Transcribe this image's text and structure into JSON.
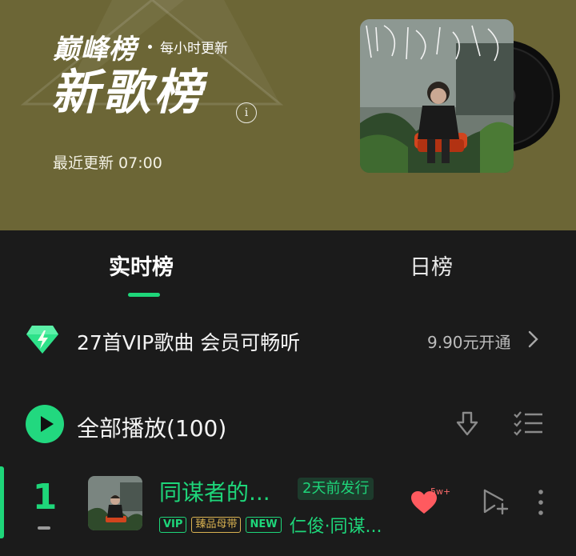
{
  "header": {
    "brand": "巅峰榜",
    "subtitle": "每小时更新",
    "title": "新歌榜",
    "last_updated": "最近更新 07:00",
    "background_color": "#6c6636"
  },
  "tabs": [
    {
      "label": "实时榜",
      "active": true
    },
    {
      "label": "日榜",
      "active": false
    }
  ],
  "vip_banner": {
    "text": "27首VIP歌曲 会员可畅听",
    "price": "9.90元开通"
  },
  "play_all": {
    "label": "全部播放(100)"
  },
  "songs": [
    {
      "rank": "1",
      "title": "同谋者的...",
      "release": "2天前发行",
      "tags": [
        "VIP",
        "臻品母带",
        "NEW"
      ],
      "artist": "仁俊·同谋...",
      "likes": "5w+"
    }
  ],
  "colors": {
    "accent": "#1ed67a",
    "background": "#1b1b1b",
    "like": "#ff5a5f"
  },
  "icons": [
    "info-icon",
    "diamond-icon",
    "chevron-right-icon",
    "play-icon",
    "download-icon",
    "multi-select-icon",
    "heart-icon",
    "add-to-queue-icon",
    "more-icon"
  ]
}
